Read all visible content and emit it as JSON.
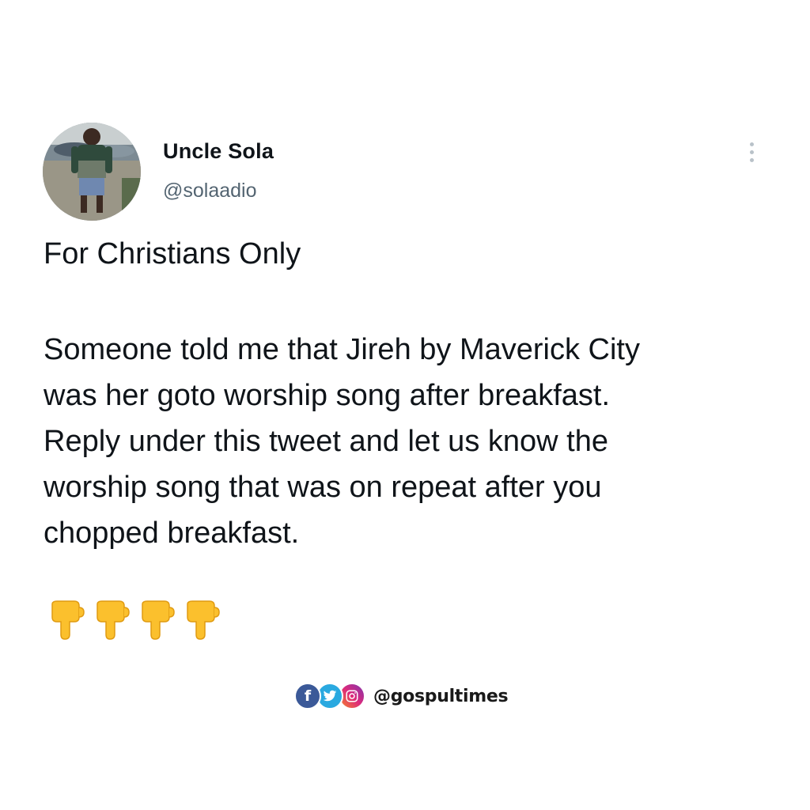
{
  "author": {
    "display_name": "Uncle Sola",
    "handle": "@solaadio",
    "avatar_icon": "profile-photo"
  },
  "tweet": {
    "heading": "For Christians Only",
    "body_lines": [
      "Someone told me that Jireh by Maverick City",
      "was her goto worship song after breakfast.",
      "Reply under this tweet and let us know the",
      "worship song that was on repeat after you",
      "chopped breakfast."
    ],
    "emoji": [
      "👇",
      "👇",
      "👇",
      "👇"
    ]
  },
  "more_icon": "more-vertical-icon",
  "watermark": {
    "text": "@gospultimes",
    "icons": [
      "facebook-icon",
      "twitter-icon",
      "instagram-icon"
    ],
    "colors": {
      "facebook": "#3b5998",
      "twitter": "#2aa9e0",
      "instagram": "#dd2a7b"
    }
  },
  "colors": {
    "text_primary": "#0f1419",
    "text_secondary": "#536471",
    "emoji_hand": "#fbc02d"
  }
}
